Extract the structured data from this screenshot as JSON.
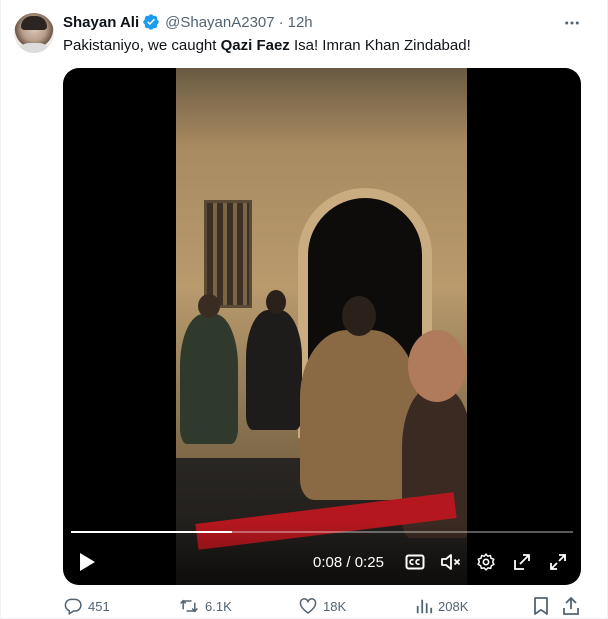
{
  "tweet": {
    "author_name": "Shayan Ali",
    "handle": "@ShayanA2307",
    "separator": "·",
    "timestamp": "12h",
    "text_before": "Pakistaniyo, we caught ",
    "text_bold": "Qazi Faez",
    "text_after": " Isa! Imran Khan Zindabad!",
    "verified_color": "#1d9bf0"
  },
  "video": {
    "current_time": "0:08",
    "time_separator": " / ",
    "duration": "0:25",
    "progress_fraction": 0.32,
    "icons": [
      "play-icon",
      "captions-icon",
      "mute-icon",
      "settings-icon",
      "pop-out-icon",
      "fullscreen-icon"
    ]
  },
  "actions": {
    "replies": "451",
    "reposts": "6.1K",
    "likes": "18K",
    "views": "208K",
    "icons": [
      "reply-icon",
      "repost-icon",
      "like-icon",
      "views-icon",
      "bookmark-icon",
      "share-icon"
    ]
  },
  "colors": {
    "text_secondary": "#536471",
    "text_primary": "#0f1419"
  }
}
